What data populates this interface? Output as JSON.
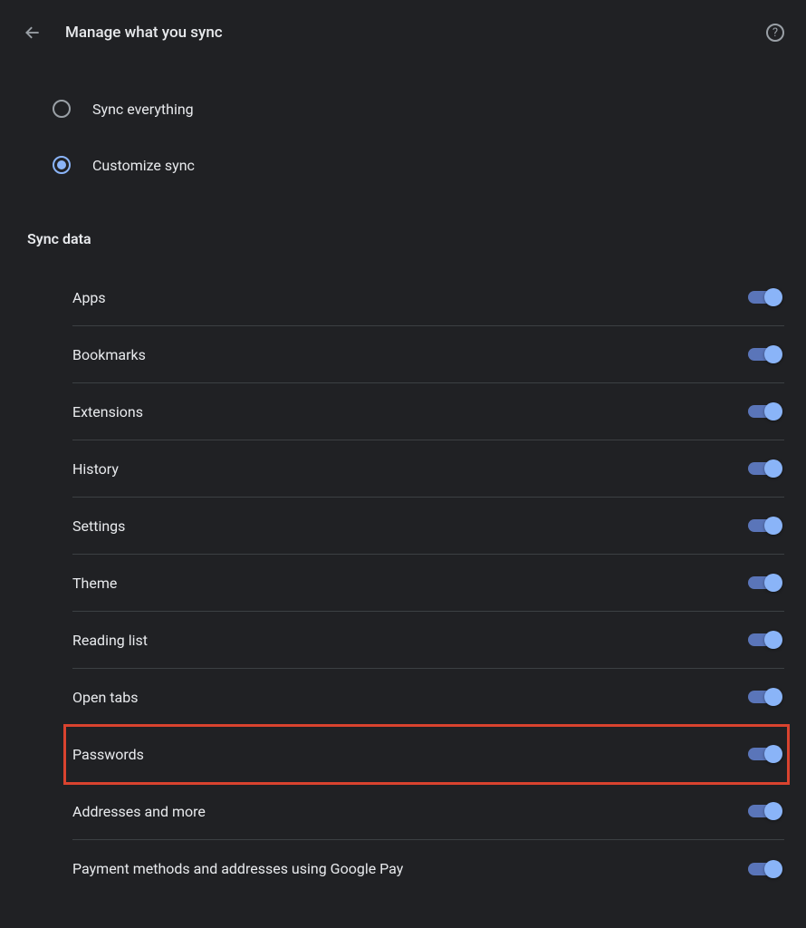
{
  "header": {
    "title": "Manage what you sync"
  },
  "radios": {
    "sync_everything": {
      "label": "Sync everything",
      "selected": false
    },
    "customize_sync": {
      "label": "Customize sync",
      "selected": true
    }
  },
  "section_title": "Sync data",
  "toggles": [
    {
      "label": "Apps",
      "on": true,
      "highlighted": false
    },
    {
      "label": "Bookmarks",
      "on": true,
      "highlighted": false
    },
    {
      "label": "Extensions",
      "on": true,
      "highlighted": false
    },
    {
      "label": "History",
      "on": true,
      "highlighted": false
    },
    {
      "label": "Settings",
      "on": true,
      "highlighted": false
    },
    {
      "label": "Theme",
      "on": true,
      "highlighted": false
    },
    {
      "label": "Reading list",
      "on": true,
      "highlighted": false
    },
    {
      "label": "Open tabs",
      "on": true,
      "highlighted": false
    },
    {
      "label": "Passwords",
      "on": true,
      "highlighted": true
    },
    {
      "label": "Addresses and more",
      "on": true,
      "highlighted": false
    },
    {
      "label": "Payment methods and addresses using Google Pay",
      "on": true,
      "highlighted": false
    }
  ]
}
